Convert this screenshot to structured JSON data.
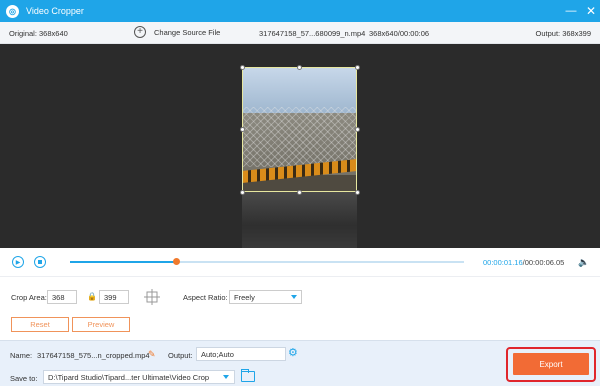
{
  "window": {
    "title": "Video Cropper",
    "minimize_icon": "minimize-icon",
    "close_icon": "close-icon"
  },
  "info_bar": {
    "original": "Original: 368x640",
    "change_source": "Change Source File",
    "file_name": "317647158_57...680099_n.mp4",
    "file_info": "368x640/00:00:06",
    "output": "Output: 368x399"
  },
  "player": {
    "current_time": "00:00:01.16",
    "separator": "/",
    "total_time": "00:00:06.05",
    "progress": 0.27
  },
  "crop": {
    "label": "Crop Area:",
    "width": "368",
    "height": "399",
    "aspect_label": "Aspect Ratio:",
    "aspect_value": "Freely"
  },
  "buttons": {
    "reset": "Reset",
    "preview": "Preview",
    "export": "Export"
  },
  "bottom": {
    "name_label": "Name:",
    "name_value": "317647158_575...n_cropped.mp4",
    "output_label": "Output:",
    "output_value": "Auto;Auto",
    "save_label": "Save to:",
    "save_path": "D:\\Tipard Studio\\Tipard...ter Ultimate\\Video Crop"
  },
  "colors": {
    "accent": "#1fa5e8",
    "export": "#f26b35",
    "highlight": "#e0262c"
  }
}
